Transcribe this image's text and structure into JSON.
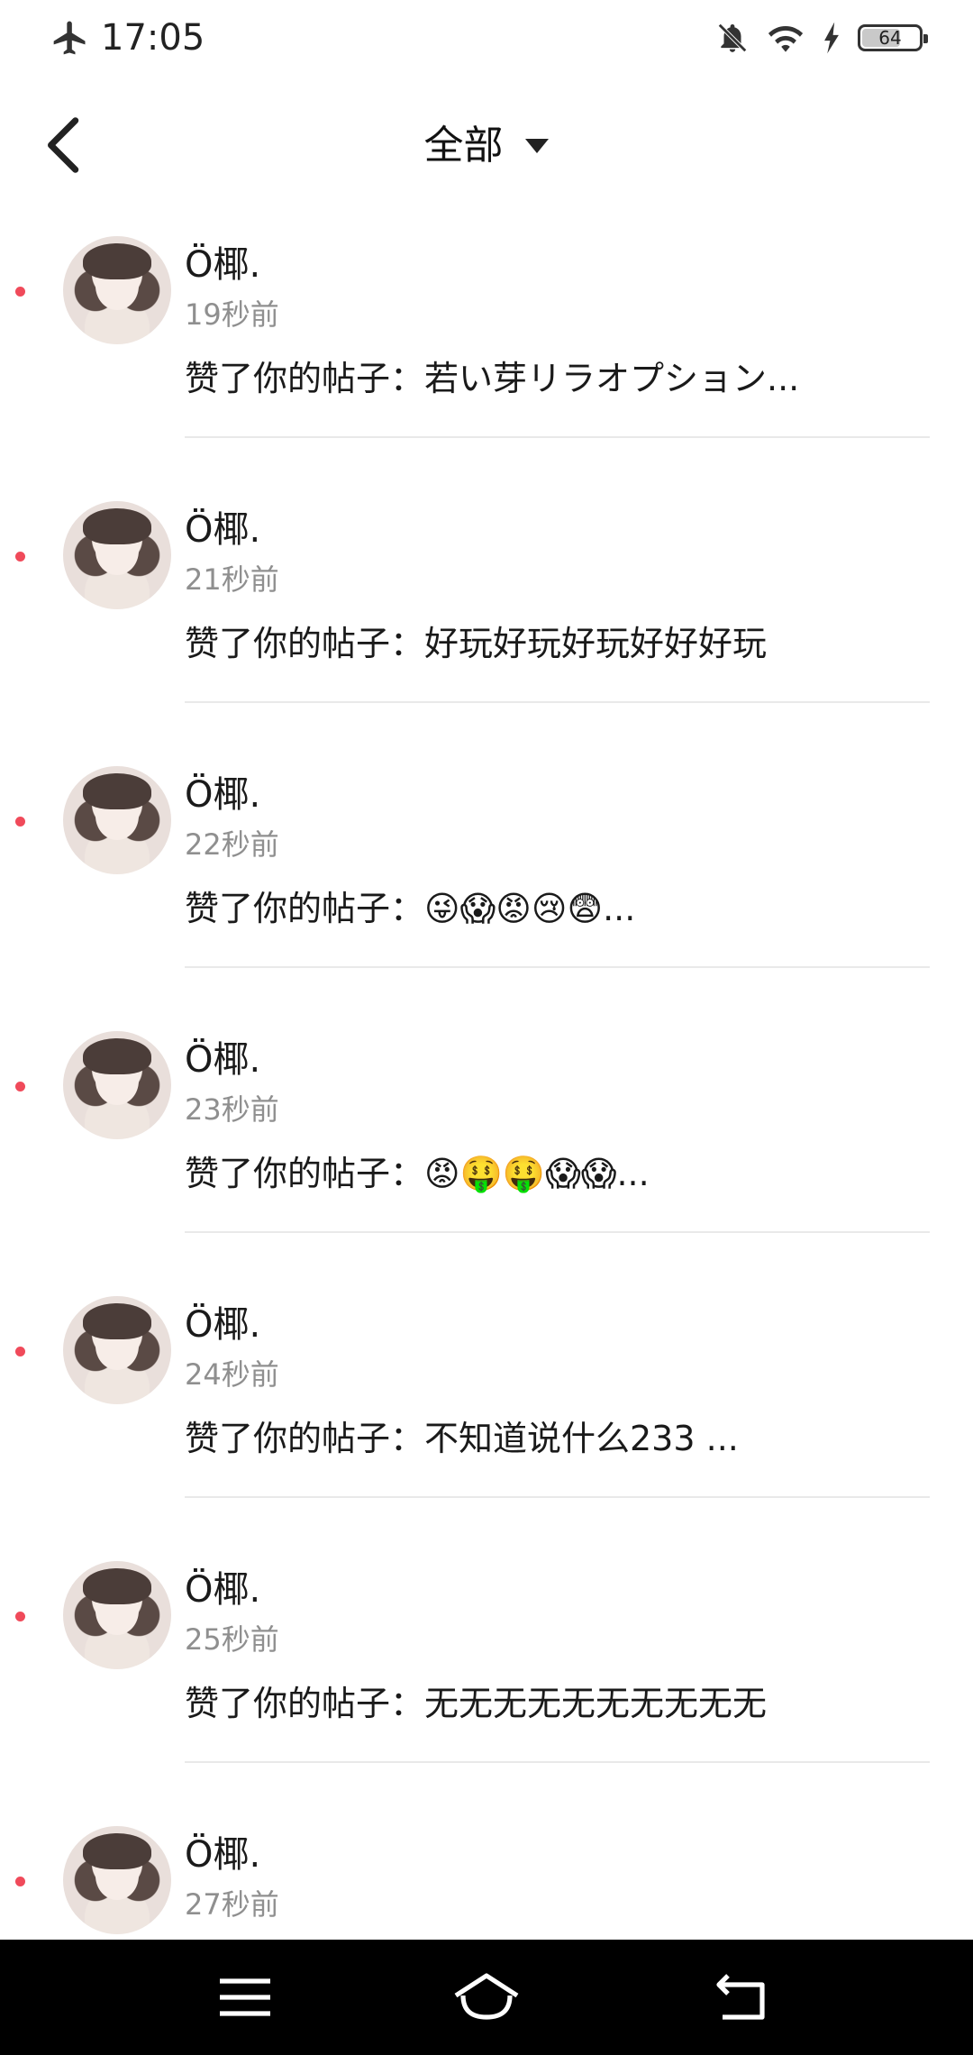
{
  "status_bar": {
    "time": "17:05",
    "battery_level": "64",
    "icons": [
      "airplane-icon",
      "mute-bell-icon",
      "wifi-icon",
      "charging-bolt-icon",
      "battery-icon"
    ]
  },
  "header": {
    "title": "全部",
    "back_icon": "chevron-left-icon",
    "dropdown_icon": "caret-down-icon"
  },
  "notifications": [
    {
      "name": "Ö椰.",
      "time": "19秒前",
      "message": "赞了你的帖子：若い芽リラオプション..."
    },
    {
      "name": "Ö椰.",
      "time": "21秒前",
      "message": "赞了你的帖子：好玩好玩好玩好好好玩"
    },
    {
      "name": "Ö椰.",
      "time": "22秒前",
      "message": "赞了你的帖子：😜😱😡😢😨..."
    },
    {
      "name": "Ö椰.",
      "time": "23秒前",
      "message": "赞了你的帖子：😡🤑🤑😱😱..."
    },
    {
      "name": "Ö椰.",
      "time": "24秒前",
      "message": "赞了你的帖子：不知道说什么233 ..."
    },
    {
      "name": "Ö椰.",
      "time": "25秒前",
      "message": "赞了你的帖子：无无无无无无无无无无"
    },
    {
      "name": "Ö椰.",
      "time": "27秒前",
      "message": ""
    }
  ],
  "unread_color": "#f04a5a",
  "nav_bar": {
    "buttons": [
      "menu-icon",
      "home-icon",
      "back-icon"
    ]
  }
}
